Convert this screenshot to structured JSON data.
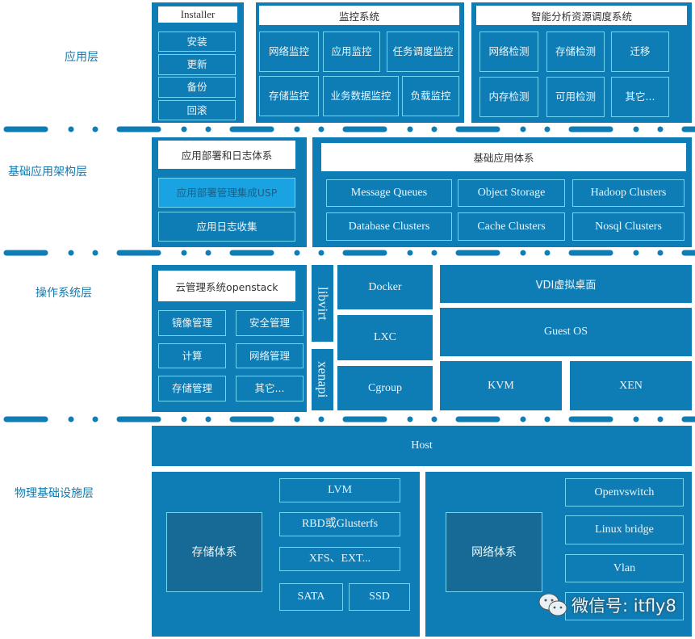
{
  "layers": {
    "app": "应用层",
    "base_app": "基础应用架构层",
    "os": "操作系统层",
    "physical": "物理基础设施层"
  },
  "installer": {
    "title": "Installer",
    "items": [
      "安装",
      "更新",
      "备份",
      "回滚"
    ]
  },
  "monitor": {
    "title": "监控系统",
    "items": [
      "网络监控",
      "应用监控",
      "任务调度监控",
      "存储监控",
      "业务数据监控",
      "负载监控"
    ]
  },
  "smart": {
    "title": "智能分析资源调度系统",
    "items": [
      "网络检测",
      "存储检测",
      "迁移",
      "内存检测",
      "可用检测",
      "其它..."
    ]
  },
  "deploy": {
    "title": "应用部署和日志体系",
    "items": [
      "应用部署管理集成USP",
      "应用日志收集"
    ]
  },
  "base": {
    "title": "基础应用体系",
    "items": [
      "Message Queues",
      "Object Storage",
      "Hadoop Clusters",
      "Database Clusters",
      "Cache Clusters",
      "Nosql Clusters"
    ]
  },
  "openstack": {
    "title": "云管理系统openstack",
    "items": [
      "镜像管理",
      "安全管理",
      "计算",
      "网络管理",
      "存储管理",
      "其它..."
    ]
  },
  "os": {
    "libvirt": "libvirt",
    "xenapi": "xenapi",
    "containers": [
      "Docker",
      "LXC",
      "Cgroup"
    ],
    "vdi": "VDI虚拟桌面",
    "guest": "Guest OS",
    "kvm": "KVM",
    "xen": "XEN"
  },
  "host": "Host",
  "storage": {
    "title": "存储体系",
    "items": [
      "LVM",
      "RBD或Glusterfs",
      "XFS、EXT...",
      "SATA",
      "SSD"
    ]
  },
  "network": {
    "title": "网络体系",
    "items": [
      "Openvswitch",
      "Linux bridge",
      "Vlan"
    ]
  },
  "watermark": {
    "text": "微信号: itfly8",
    "icon": "wechat-icon"
  },
  "colors": {
    "primary": "#0f7db5",
    "border": "#6fd6f6",
    "dark": "#176a95",
    "highlight": "#1aa3e2"
  }
}
